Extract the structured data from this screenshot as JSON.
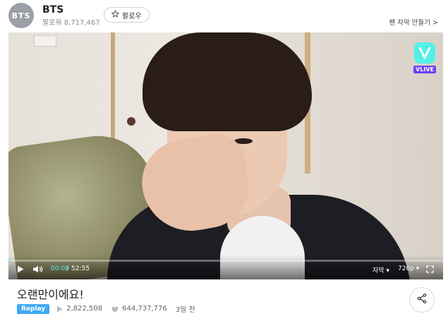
{
  "channel": {
    "avatar_text": "BTS",
    "name": "BTS",
    "followers_label": "팔로워",
    "followers_count": "8,717,467",
    "follow_button": "팔로우",
    "follow_icon": "star-outline-icon"
  },
  "header": {
    "fan_subtitle_link": "팬 자막 만들기 >"
  },
  "player": {
    "logo_text": "VLIVE",
    "current_time": "00:08",
    "time_separator": "/",
    "duration": "52:55",
    "progress": 0.0025,
    "subtitle_button": "자막 ▾",
    "quality_button": "720p ▾",
    "accent_color": "#54f0e8"
  },
  "video": {
    "title": "오랜만이에요!",
    "replay_badge": "Replay",
    "plays": "2,822,508",
    "likes": "644,737,776",
    "uploaded": "3일 전"
  }
}
